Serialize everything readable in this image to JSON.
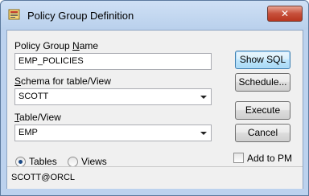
{
  "window": {
    "title": "Policy Group Definition",
    "close_glyph": "✕"
  },
  "form": {
    "policy_group_name": {
      "label_pre": "Policy Group ",
      "label_accel": "N",
      "label_post": "ame",
      "value": "EMP_POLICIES"
    },
    "schema": {
      "label_accel": "S",
      "label_post": "chema for table/View",
      "value": "SCOTT"
    },
    "table_view": {
      "label_accel": "T",
      "label_post": "able/View",
      "value": "EMP"
    },
    "object_type": {
      "tables_label": "Tables",
      "views_label": "Views",
      "selected": "Tables"
    }
  },
  "buttons": {
    "show_sql": "Show SQL",
    "schedule": "Schedule...",
    "execute": "Execute",
    "cancel": "Cancel"
  },
  "add_to_pm": {
    "label": "Add to PM",
    "checked": false
  },
  "status": {
    "connection": "SCOTT@ORCL"
  }
}
